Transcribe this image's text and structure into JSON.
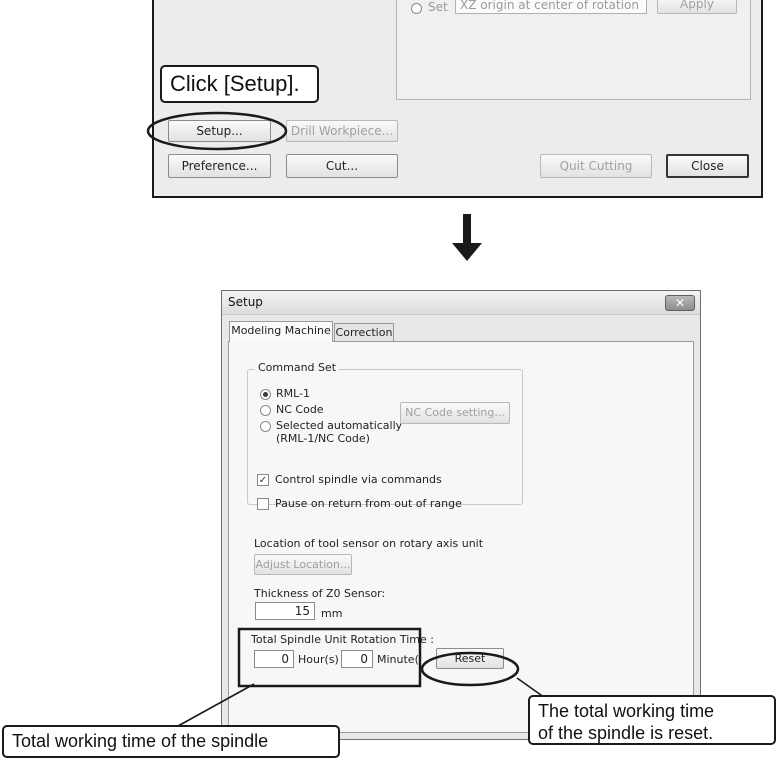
{
  "top_dialog": {
    "cut_radio_label": "Set",
    "cut_origin_text": "XZ origin at center of rotation",
    "cut_apply_label": "Apply",
    "setup_button": "Setup...",
    "drill_button": "Drill Workpiece...",
    "preference_button": "Preference...",
    "cut_button": "Cut...",
    "quit_button": "Quit Cutting",
    "close_button": "Close"
  },
  "callouts": {
    "click_setup": "Click [Setup].",
    "reset_note_line1": "The total working time",
    "reset_note_line2": "of the spindle is reset.",
    "total_time_note": "Total working time of the spindle"
  },
  "setup_dialog": {
    "title": "Setup",
    "close_glyph": "✕",
    "tabs": [
      "Modeling Machine",
      "Correction"
    ],
    "command_set": {
      "legend": "Command Set",
      "options": [
        "RML-1",
        "NC Code",
        "Selected automatically",
        "(RML-1/NC Code)"
      ],
      "selected": "RML-1",
      "nc_setting_button": "NC Code setting..."
    },
    "control_spindle": {
      "label": "Control spindle via commands",
      "checked": true
    },
    "pause_on_return": {
      "label": "Pause on return from out of range",
      "checked": false
    },
    "tool_sensor_label": "Location of tool sensor on rotary axis unit",
    "adjust_location_button": "Adjust Location...",
    "thickness_label": "Thickness of Z0 Sensor:",
    "thickness_value": "15",
    "thickness_unit": "mm",
    "rotation_label": "Total Spindle Unit Rotation Time :",
    "hours_value": "0",
    "hours_unit": "Hour(s)",
    "minutes_value": "0",
    "minutes_unit": "Minute(",
    "reset_button": "Reset"
  },
  "icons": {
    "radio": "radio-button",
    "check": "check-mark",
    "arrow": "down-arrow-icon"
  }
}
